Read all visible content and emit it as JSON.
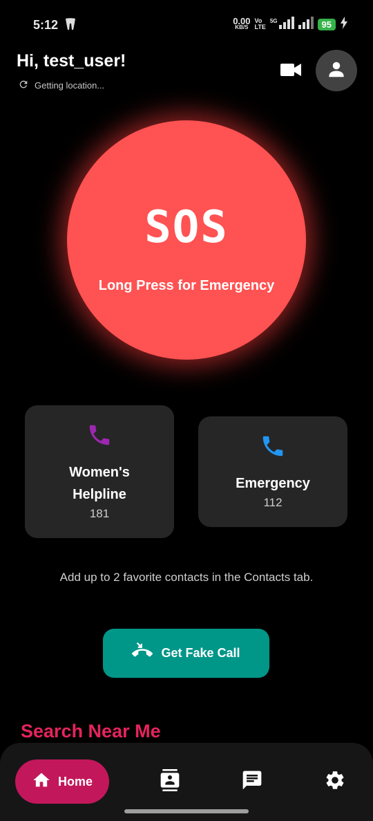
{
  "status_bar": {
    "time": "5:12",
    "net_speed_value": "0.00",
    "net_speed_unit": "KB/S",
    "volte_top": "Vo",
    "volte_bottom": "LTE",
    "network": "5G",
    "battery": "95"
  },
  "header": {
    "greeting": "Hi, test_user!",
    "location_status": "Getting location..."
  },
  "sos": {
    "title": "SOS",
    "subtitle": "Long Press for Emergency",
    "color": "#ff5252"
  },
  "cards": [
    {
      "title_line1": "Women's",
      "title_line2": "Helpline",
      "number": "181",
      "icon": "phone-icon",
      "icon_color": "#9c27b0"
    },
    {
      "title": "Emergency",
      "number": "112",
      "icon": "phone-icon",
      "icon_color": "#2196f3"
    }
  ],
  "hint": "Add up to 2 favorite contacts in the Contacts tab.",
  "fake_call": {
    "label": "Get Fake Call",
    "icon": "call-end-icon",
    "color": "#009688"
  },
  "section_title": "Search Near Me",
  "bottom_nav": {
    "home_label": "Home",
    "items": [
      "home-icon",
      "contacts-icon",
      "chat-icon",
      "settings-icon"
    ],
    "active_color": "#c2185b"
  }
}
